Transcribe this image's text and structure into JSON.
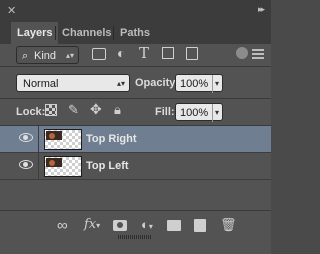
{
  "tabs": [
    {
      "label": "Layers",
      "active": true
    },
    {
      "label": "Channels",
      "active": false
    },
    {
      "label": "Paths",
      "active": false
    }
  ],
  "filter": {
    "label": "Kind"
  },
  "blend": {
    "mode": "Normal",
    "opacity_label": "Opacity:",
    "opacity_value": "100%"
  },
  "lock": {
    "label": "Lock:",
    "fill_label": "Fill:",
    "fill_value": "100%"
  },
  "layers": [
    {
      "name": "Top Right",
      "selected": true
    },
    {
      "name": "Top Left",
      "selected": false
    }
  ],
  "colors": {
    "panel": "#535353",
    "selection": "#6f7e91",
    "header": "#3c3c3c"
  }
}
